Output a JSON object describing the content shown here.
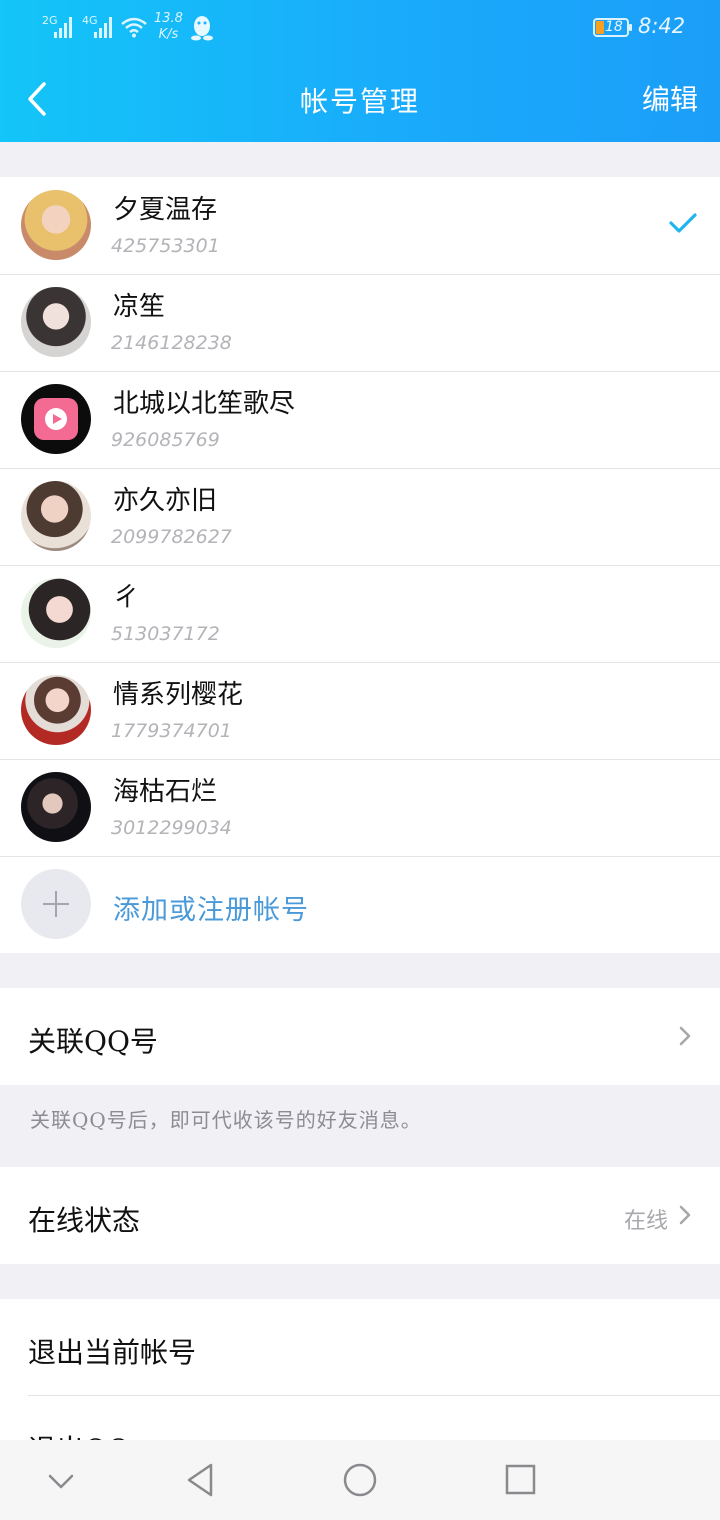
{
  "status_bar": {
    "sim1": "2G",
    "sim2": "4G",
    "speed_value": "13.8",
    "speed_unit": "K/s",
    "battery": "18",
    "time": "8:42"
  },
  "header": {
    "title": "帐号管理",
    "edit_label": "编辑"
  },
  "accounts": [
    {
      "nickname": "夕夏温存",
      "qq": "425753301",
      "selected": true
    },
    {
      "nickname": "凉笙",
      "qq": "2146128238",
      "selected": false
    },
    {
      "nickname": "北城以北笙歌尽",
      "qq": "926085769",
      "selected": false
    },
    {
      "nickname": "亦久亦旧",
      "qq": "2099782627",
      "selected": false
    },
    {
      "nickname": "ㄔ",
      "qq": "513037172",
      "selected": false
    },
    {
      "nickname": "情系列樱花",
      "qq": "1779374701",
      "selected": false
    },
    {
      "nickname": "海枯石烂",
      "qq": "3012299034",
      "selected": false
    }
  ],
  "add_account_label": "添加或注册帐号",
  "link_qq": {
    "label": "关联QQ号",
    "hint": "关联QQ号后，即可代收该号的好友消息。"
  },
  "online_status": {
    "label": "在线状态",
    "value": "在线"
  },
  "logout_current_label": "退出当前帐号",
  "logout_qq_label": "退出QQ",
  "colors": {
    "header_start": "#13c5f8",
    "header_end": "#1b9ef8",
    "accent_check": "#1fb5f0",
    "add_link": "#4a99d8"
  }
}
